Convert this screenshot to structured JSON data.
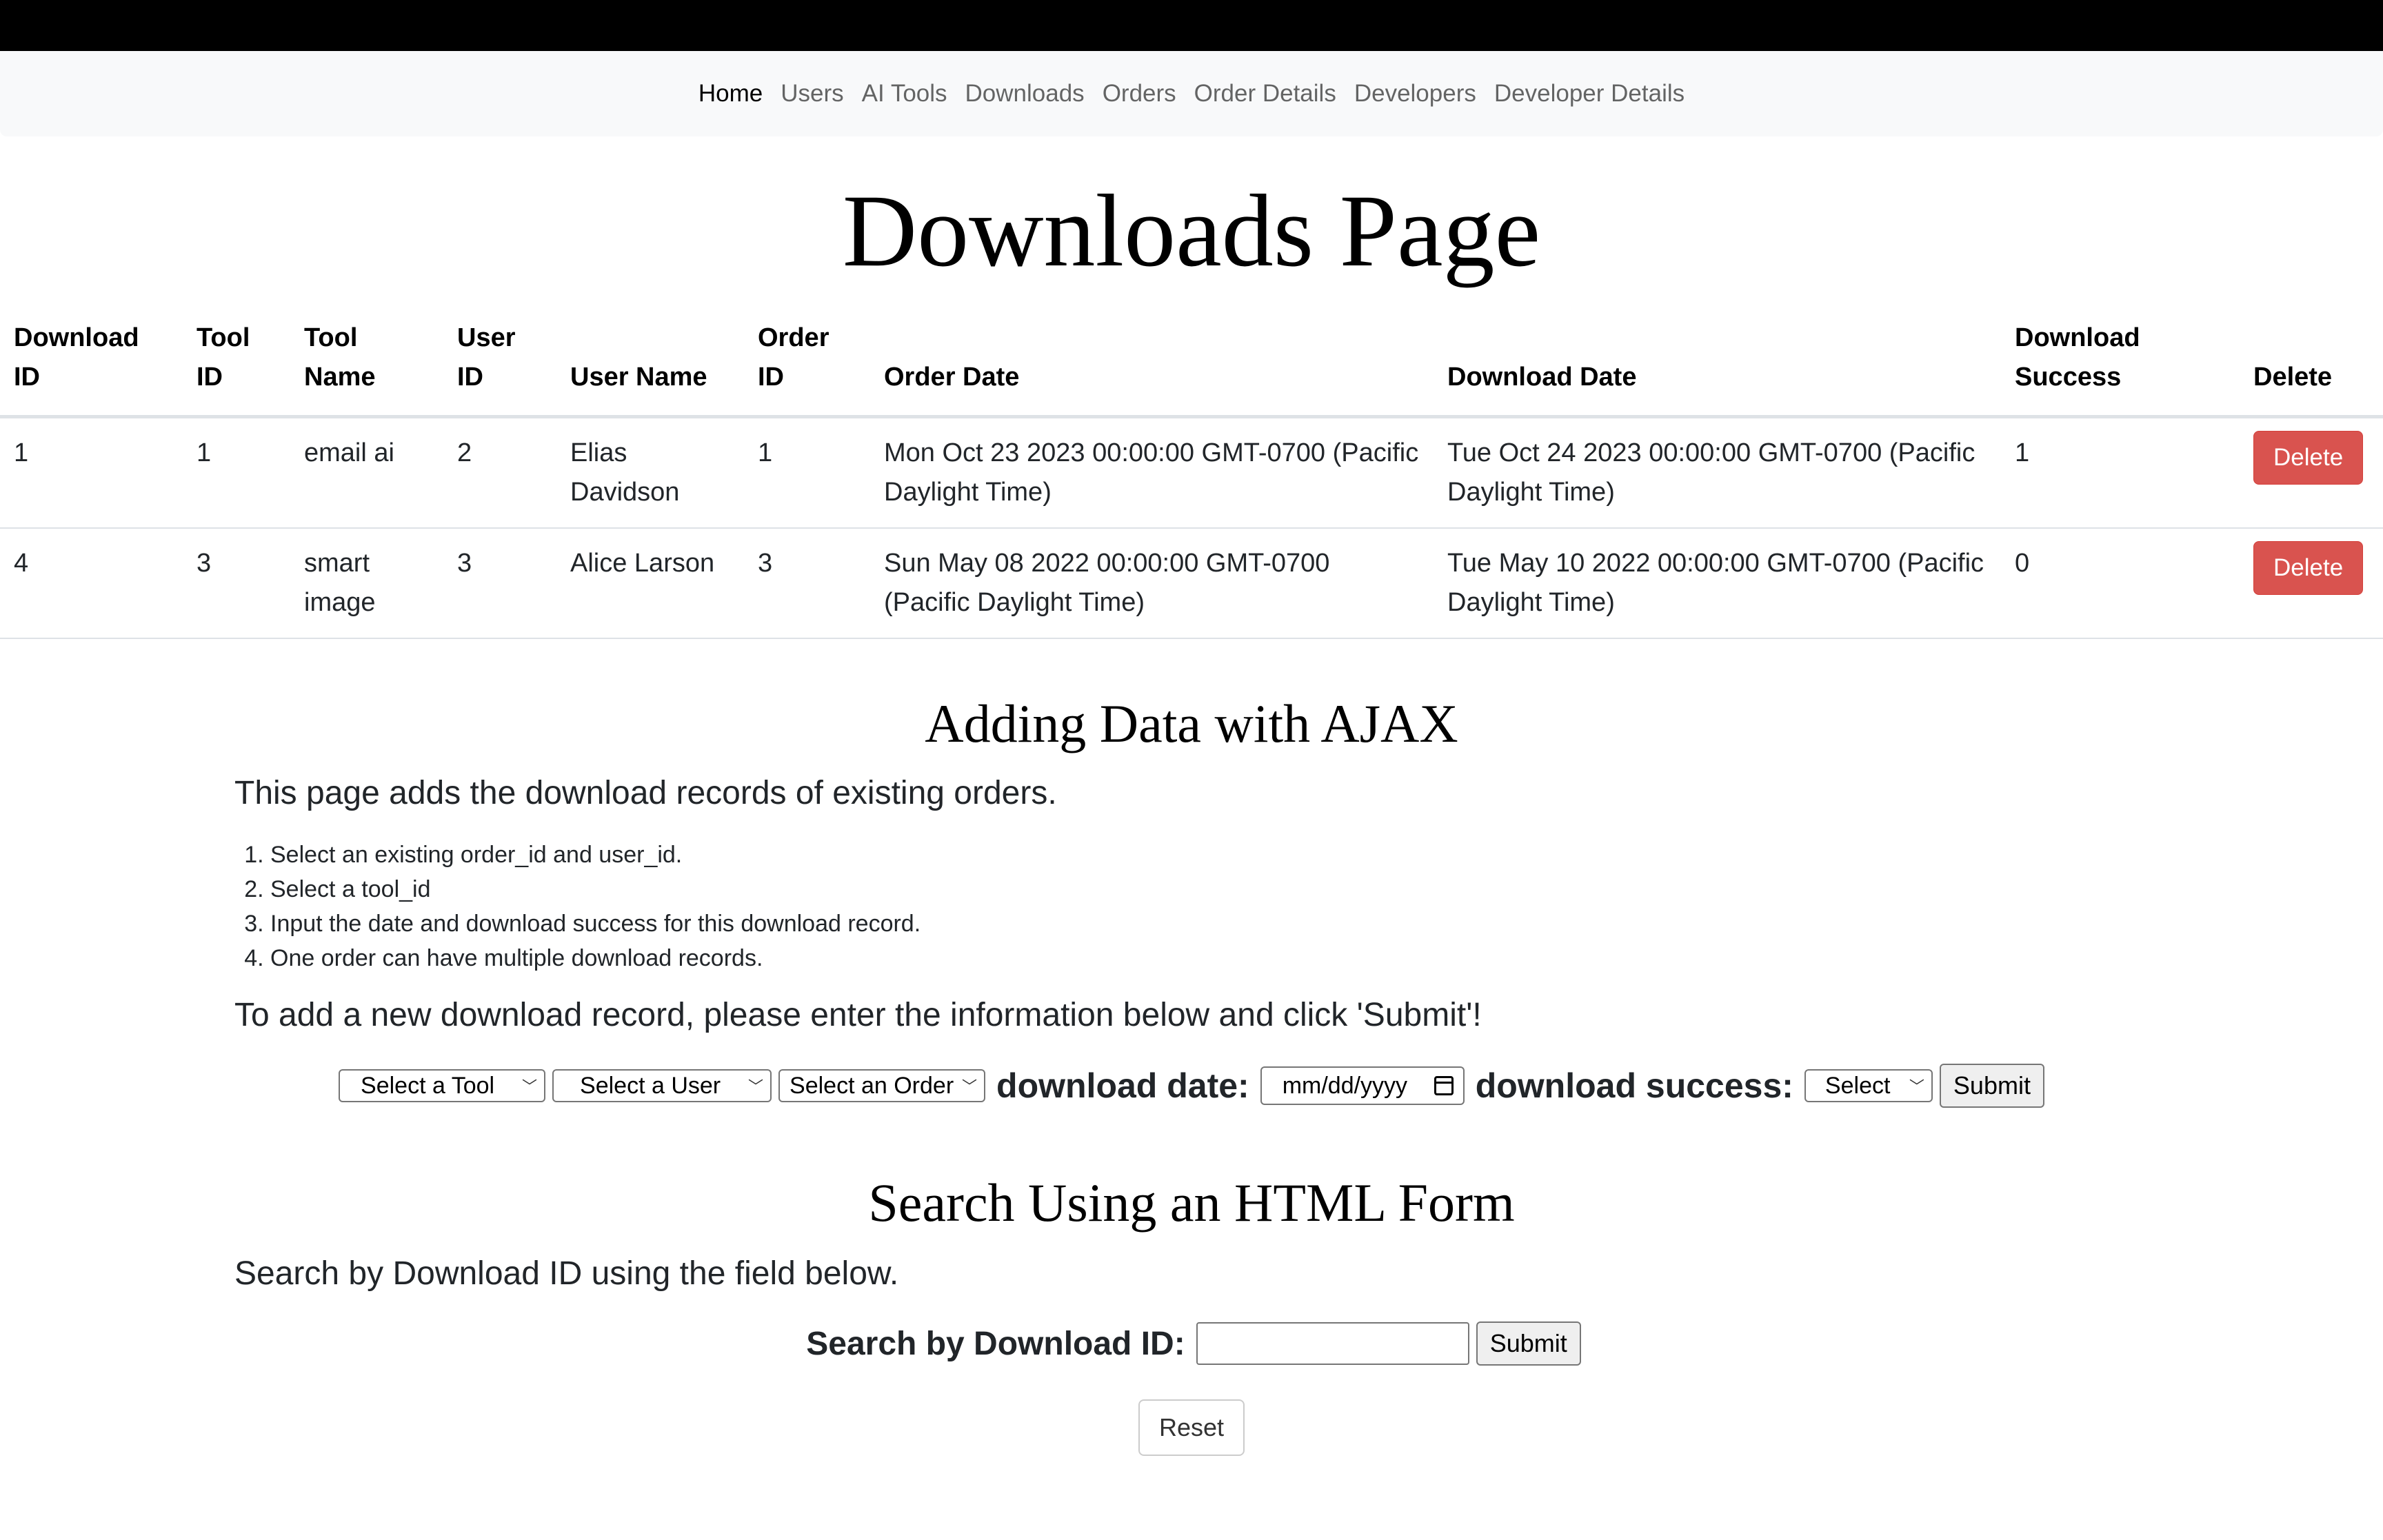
{
  "nav": {
    "items": [
      "Home",
      "Users",
      "AI Tools",
      "Downloads",
      "Orders",
      "Order Details",
      "Developers",
      "Developer Details"
    ],
    "active": "Home"
  },
  "page_title": "Downloads Page",
  "table": {
    "headers": {
      "download_id": [
        "Download",
        "ID"
      ],
      "tool_id": [
        "Tool",
        "ID"
      ],
      "tool_name": [
        "Tool",
        "Name"
      ],
      "user_id": [
        "User",
        "ID"
      ],
      "user_name": "User Name",
      "order_id": [
        "Order",
        "ID"
      ],
      "order_date": "Order Date",
      "download_date": "Download Date",
      "download_success": [
        "Download",
        "Success"
      ],
      "delete": "Delete"
    },
    "rows": [
      {
        "download_id": "1",
        "tool_id": "1",
        "tool_name": "email ai",
        "user_id": "2",
        "user_name": "Elias Davidson",
        "order_id": "1",
        "order_date": "Mon Oct 23 2023 00:00:00 GMT-0700 (Pacific Daylight Time)",
        "download_date": "Tue Oct 24 2023 00:00:00 GMT-0700 (Pacific Daylight Time)",
        "download_success": "1",
        "delete_label": "Delete"
      },
      {
        "download_id": "4",
        "tool_id": "3",
        "tool_name": "smart image",
        "user_id": "3",
        "user_name": "Alice Larson",
        "order_id": "3",
        "order_date": "Sun May 08 2022 00:00:00 GMT-0700 (Pacific Daylight Time)",
        "download_date": "Tue May 10 2022 00:00:00 GMT-0700 (Pacific Daylight Time)",
        "download_success": "0",
        "delete_label": "Delete"
      }
    ]
  },
  "add_section": {
    "title": "Adding Data with AJAX",
    "intro": "This page adds the download records of existing orders.",
    "steps": [
      "Select an existing order_id and user_id.",
      "Select a tool_id",
      "Input the date and download success for this download record.",
      "One order can have multiple download records."
    ],
    "instruction": "To add a new download record, please enter the information below and click 'Submit'!",
    "tool_select": "Select a Tool",
    "user_select": "Select a User",
    "order_select": "Select an Order",
    "date_label": "download date:",
    "date_placeholder": "mm/dd/yyyy",
    "success_label": "download success:",
    "success_select": "Select",
    "submit_label": "Submit"
  },
  "search_section": {
    "title": "Search Using an HTML Form",
    "intro": "Search by Download ID using the field below.",
    "label": "Search by Download ID:",
    "input_value": "",
    "submit_label": "Submit",
    "reset_label": "Reset"
  }
}
